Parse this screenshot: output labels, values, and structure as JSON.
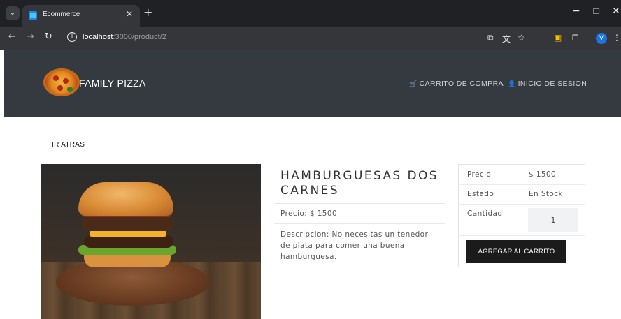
{
  "browser": {
    "tab_title": "Ecommerce",
    "url_host": "localhost",
    "url_path": ":3000/product/2",
    "profile_initial": "V"
  },
  "header": {
    "brand": "FAMILY PIZZA",
    "nav": [
      {
        "label": "CARRITO DE COMPRA",
        "icon": "shopping-cart-icon"
      },
      {
        "label": "INICIO DE SESION",
        "icon": "user-icon"
      }
    ],
    "background_color": "#343a40"
  },
  "page": {
    "back_label": "IR ATRAS",
    "product": {
      "title": "HAMBURGUESAS DOS CARNES",
      "price_text": "Precio: $ 1500",
      "description": "Descripcion: No necesitas un tenedor de plata para comer una buena hamburguesa."
    },
    "purchase_card": {
      "price_label": "Precio",
      "price_value": "$ 1500",
      "status_label": "Estado",
      "status_value": "En Stock",
      "quantity_label": "Cantidad",
      "quantity_value": "1",
      "add_button": "AGREGAR AL CARRITO"
    }
  }
}
